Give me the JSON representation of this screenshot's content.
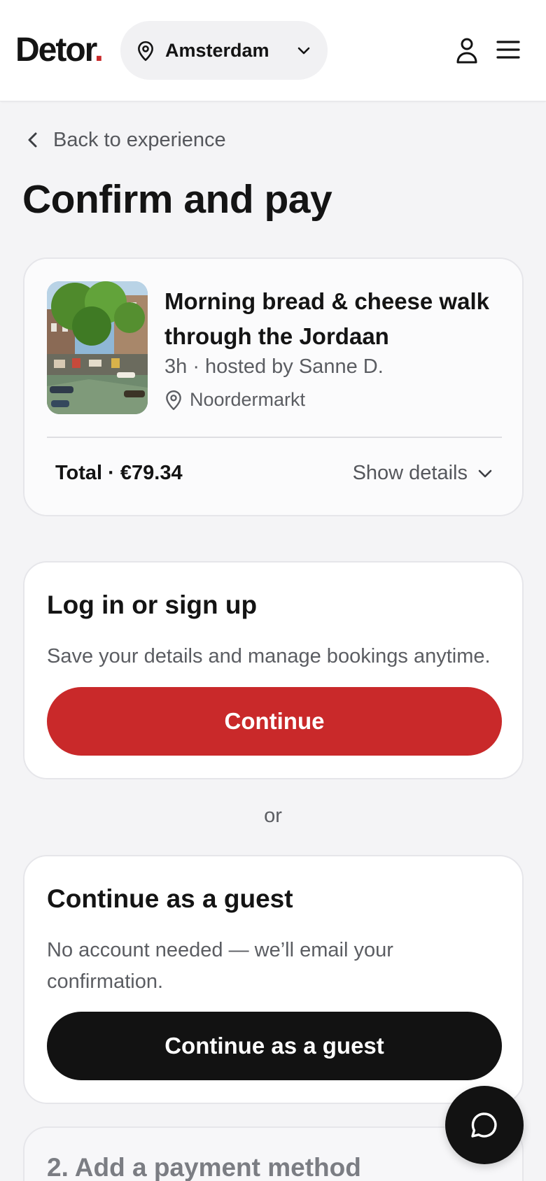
{
  "header": {
    "logo_text": "Detor",
    "logo_dot": ".",
    "city": "Amsterdam",
    "icons": [
      "map-pin-icon",
      "chevron-down-icon",
      "user-icon",
      "menu-icon"
    ]
  },
  "nav": {
    "back_label": "Back to experience"
  },
  "page": {
    "title": "Confirm and pay"
  },
  "summary": {
    "experience_title": "Morning bread & cheese walk through the Jordaan",
    "meta": "3h · hosted by Sanne D.",
    "location": "Noordermarkt",
    "total": "Total · €79.34",
    "show_details_label": "Show details"
  },
  "login": {
    "heading": "Log in or sign up",
    "description": "Save your details and manage bookings anytime.",
    "button_label": "Continue"
  },
  "separator": "or",
  "guest": {
    "heading": "Continue as a guest",
    "description": "No account needed — we’ll email your confirmation.",
    "button_label": "Continue as a guest"
  },
  "payment": {
    "heading": "2. Add a payment method"
  },
  "colors": {
    "brand_red": "#c9292a",
    "primary_black": "#121212",
    "background": "#f4f4f6"
  }
}
